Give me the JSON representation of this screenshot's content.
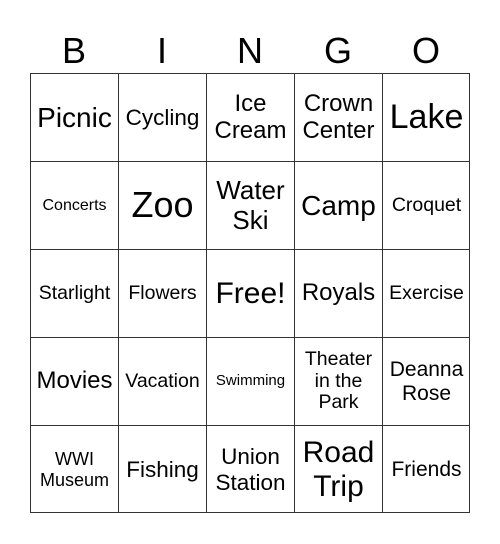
{
  "header": {
    "letters": [
      "B",
      "I",
      "N",
      "G",
      "O"
    ]
  },
  "grid": {
    "cells": [
      {
        "text": "Picnic",
        "size": "xl"
      },
      {
        "text": "Cycling",
        "size": "m"
      },
      {
        "text": "Ice\nCream",
        "size": "l"
      },
      {
        "text": "Crown\nCenter",
        "size": "l"
      },
      {
        "text": "Lake",
        "size": "xxl"
      },
      {
        "text": "Concerts",
        "size": "xs"
      },
      {
        "text": "Zoo",
        "size": "xxxl"
      },
      {
        "text": "Water\nSki",
        "size": "l2"
      },
      {
        "text": "Camp",
        "size": "xl"
      },
      {
        "text": "Croquet",
        "size": "s"
      },
      {
        "text": "Starlight",
        "size": "s"
      },
      {
        "text": "Flowers",
        "size": "s"
      },
      {
        "text": "Free!",
        "size": "xl2"
      },
      {
        "text": "Royals",
        "size": "l"
      },
      {
        "text": "Exercise",
        "size": "s"
      },
      {
        "text": "Movies",
        "size": "l"
      },
      {
        "text": "Vacation",
        "size": "s"
      },
      {
        "text": "Swimming",
        "size": "xxs"
      },
      {
        "text": "Theater\nin the\nPark",
        "size": "s"
      },
      {
        "text": "Deanna\nRose",
        "size": "s2"
      },
      {
        "text": "WWI\nMuseum",
        "size": "xs2"
      },
      {
        "text": "Fishing",
        "size": "m"
      },
      {
        "text": "Union\nStation",
        "size": "m"
      },
      {
        "text": "Road\nTrip",
        "size": "xl2"
      },
      {
        "text": "Friends",
        "size": "s2"
      }
    ]
  }
}
